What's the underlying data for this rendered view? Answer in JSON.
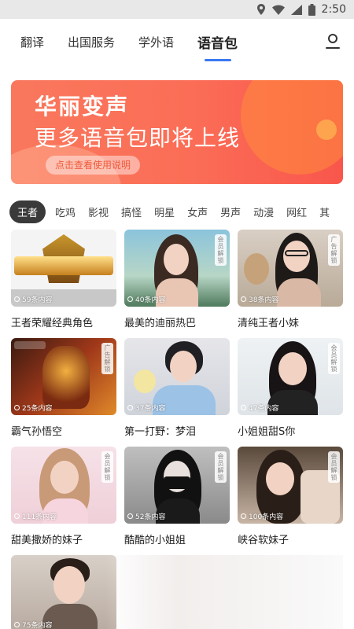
{
  "status_bar": {
    "time": "2:50"
  },
  "top_nav": {
    "tabs": [
      {
        "label": "翻译",
        "active": false
      },
      {
        "label": "出国服务",
        "active": false
      },
      {
        "label": "学外语",
        "active": false
      },
      {
        "label": "语音包",
        "active": true
      }
    ],
    "accent_color": "#3a78f2"
  },
  "banner": {
    "title": "华丽变声",
    "subtitle": "更多语音包即将上线",
    "button_label": "点击查看使用说明",
    "colors": [
      "#f9785d",
      "#f9564c"
    ]
  },
  "categories": {
    "items": [
      "王者",
      "吃鸡",
      "影视",
      "搞怪",
      "明星",
      "女声",
      "男声",
      "动漫",
      "网红",
      "其"
    ],
    "selected": "王者"
  },
  "cards": [
    {
      "title": "王者荣耀经典角色",
      "count": "59条内容",
      "badge": ""
    },
    {
      "title": "最美的迪丽热巴",
      "count": "40条内容",
      "badge": "会员解锁"
    },
    {
      "title": "清纯王者小妹",
      "count": "38条内容",
      "badge": "广告解锁"
    },
    {
      "title": "霸气孙悟空",
      "count": "25条内容",
      "badge": "广告解锁"
    },
    {
      "title": "第一打野：梦泪",
      "count": "37条内容",
      "badge": ""
    },
    {
      "title": "小姐姐甜S你",
      "count": "47条内容",
      "badge": "会员解锁"
    },
    {
      "title": "甜美撒娇的妹子",
      "count": "111条内容",
      "badge": "会员解锁"
    },
    {
      "title": "酷酷的小姐姐",
      "count": "52条内容",
      "badge": "会员解锁"
    },
    {
      "title": "峡谷软妹子",
      "count": "100条内容",
      "badge": "会员解锁"
    },
    {
      "title": "",
      "count": "75条内容",
      "badge": ""
    }
  ]
}
